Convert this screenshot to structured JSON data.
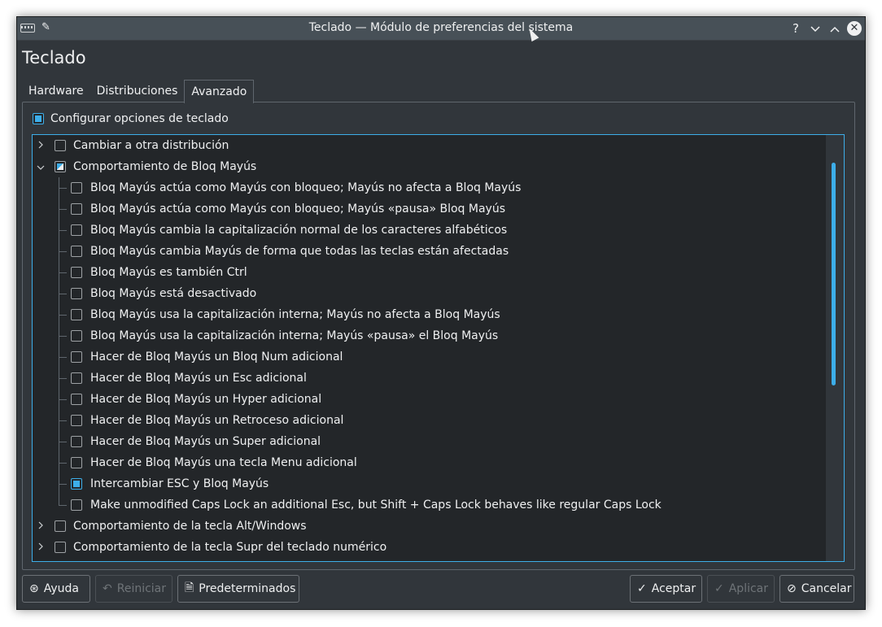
{
  "window": {
    "title": "Teclado — Módulo de preferencias del sistema",
    "help_glyph": "?",
    "minimize_glyph": "⌄",
    "maximize_glyph": "⌃",
    "close_glyph": "✕",
    "pin_glyph": "📌"
  },
  "page": {
    "heading": "Teclado"
  },
  "tabs": [
    {
      "label": "Hardware"
    },
    {
      "label": "Distribuciones"
    },
    {
      "label": "Avanzado",
      "active": true
    }
  ],
  "config": {
    "label": "Configurar opciones de teclado",
    "checked": true
  },
  "tree": {
    "groups": [
      {
        "label": "Cambiar a otra distribución",
        "expanded": false,
        "state": "unchecked"
      },
      {
        "label": "Comportamiento de Bloq Mayús",
        "expanded": true,
        "state": "partial",
        "children": [
          {
            "label": "Bloq Mayús actúa como Mayús con bloqueo; Mayús no afecta a Bloq Mayús",
            "checked": false
          },
          {
            "label": "Bloq Mayús actúa como Mayús con bloqueo; Mayús «pausa» Bloq Mayús",
            "checked": false
          },
          {
            "label": "Bloq Mayús cambia la capitalización normal de los caracteres alfabéticos",
            "checked": false
          },
          {
            "label": "Bloq Mayús cambia Mayús de forma que todas las teclas están afectadas",
            "checked": false
          },
          {
            "label": "Bloq Mayús es también Ctrl",
            "checked": false
          },
          {
            "label": "Bloq Mayús está desactivado",
            "checked": false
          },
          {
            "label": "Bloq Mayús usa la capitalización interna; Mayús no afecta a Bloq Mayús",
            "checked": false
          },
          {
            "label": "Bloq Mayús usa la capitalización interna; Mayús «pausa» el Bloq Mayús",
            "checked": false
          },
          {
            "label": "Hacer de Bloq Mayús un Bloq Num adicional",
            "checked": false
          },
          {
            "label": "Hacer de Bloq Mayús un Esc adicional",
            "checked": false
          },
          {
            "label": "Hacer de Bloq Mayús un Hyper adicional",
            "checked": false
          },
          {
            "label": "Hacer de Bloq Mayús un Retroceso adicional",
            "checked": false
          },
          {
            "label": "Hacer de Bloq Mayús un Super adicional",
            "checked": false
          },
          {
            "label": "Hacer de Bloq Mayús una tecla Menu adicional",
            "checked": false
          },
          {
            "label": "Intercambiar ESC y Bloq Mayús",
            "checked": true
          },
          {
            "label": "Make unmodified Caps Lock an additional Esc, but Shift + Caps Lock behaves like regular Caps Lock",
            "checked": false
          }
        ]
      },
      {
        "label": "Comportamiento de la tecla Alt/Windows",
        "expanded": false,
        "state": "unchecked"
      },
      {
        "label": "Comportamiento de la tecla Supr del teclado numérico",
        "expanded": false,
        "state": "unchecked"
      }
    ]
  },
  "buttons": {
    "help": "Ayuda",
    "reset": "Reiniciar",
    "defaults": "Predeterminados",
    "accept": "Aceptar",
    "apply": "Aplicar",
    "cancel": "Cancelar"
  },
  "colors": {
    "accent": "#3daee9",
    "window_bg": "#31363b",
    "view_bg": "#232629",
    "text": "#eff0f1"
  }
}
